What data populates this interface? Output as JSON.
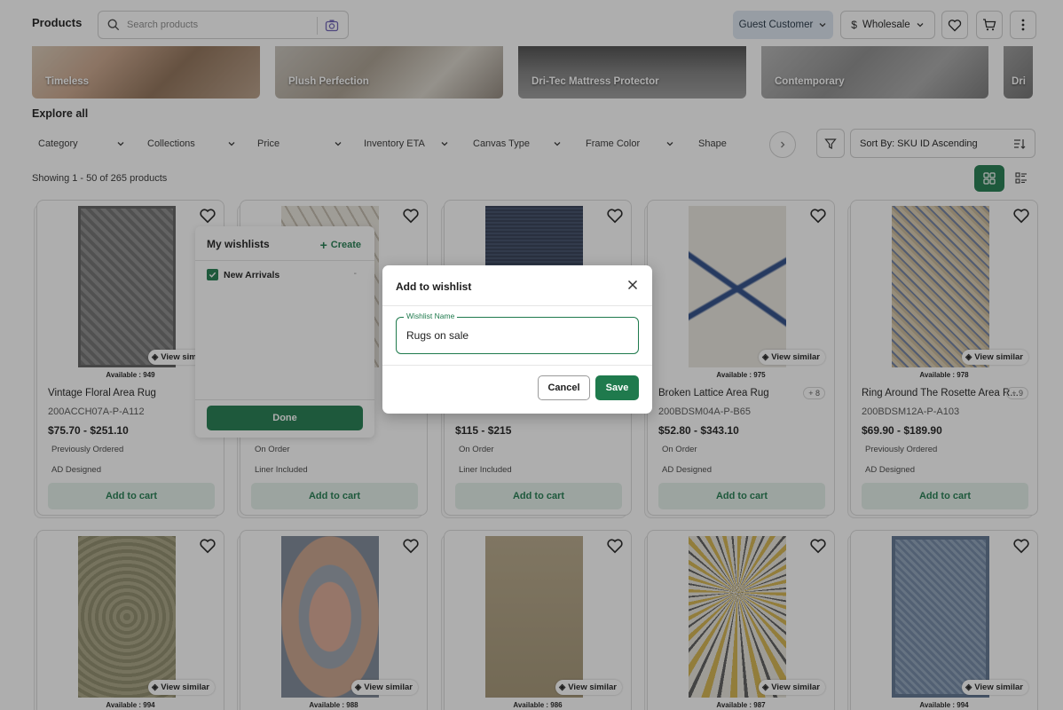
{
  "header": {
    "title": "Products",
    "search_placeholder": "Search products",
    "customer": "Guest Customer",
    "pricing": "Wholesale"
  },
  "collections": [
    "Timeless",
    "Plush Perfection",
    "Dri-Tec Mattress Protector",
    "Contemporary",
    "Dri"
  ],
  "explore_title": "Explore all",
  "filters": [
    "Category",
    "Collections",
    "Price",
    "Inventory ETA",
    "Canvas Type",
    "Frame Color",
    "Shape"
  ],
  "sort_label": "Sort By: SKU ID Ascending",
  "showing": "Showing 1 - 50 of 265 products",
  "view_similar": "View similar",
  "add_to_cart": "Add to cart",
  "products_row1": [
    {
      "availability": "Available : 949",
      "title": "Vintage Floral Area Rug",
      "sku": "200ACCH07A-P-A112",
      "price": "$75.70 - $251.10",
      "tag1": "Previously Ordered",
      "tag2": "AD Designed",
      "variants": ""
    },
    {
      "availability": "",
      "title": "",
      "sku": "",
      "price": "",
      "tag1": "On Order",
      "tag2": "Liner Included",
      "variants": ""
    },
    {
      "availability": "",
      "title": "",
      "sku": "",
      "price": "$115 - $215",
      "tag1": "On Order",
      "tag2": "Liner Included",
      "variants": ""
    },
    {
      "availability": "Available : 975",
      "title": "Broken Lattice Area Rug",
      "sku": "200BDSM04A-P-B65",
      "price": "$52.80 - $343.10",
      "tag1": "On Order",
      "tag2": "AD Designed",
      "variants": "+ 8"
    },
    {
      "availability": "Available : 978",
      "title": "Ring Around The Rosette Area R...",
      "sku": "200BDSM12A-P-A103",
      "price": "$69.90 - $189.90",
      "tag1": "Previously Ordered",
      "tag2": "AD Designed",
      "variants": "+ 9"
    }
  ],
  "products_row2": [
    {
      "availability": "Available : 994"
    },
    {
      "availability": "Available : 988"
    },
    {
      "availability": "Available : 986"
    },
    {
      "availability": "Available : 987"
    },
    {
      "availability": "Available : 994"
    }
  ],
  "wishlists_panel": {
    "title": "My wishlists",
    "create": "Create",
    "item": "New Arrivals",
    "item_count": "-",
    "done": "Done"
  },
  "modal": {
    "title": "Add to wishlist",
    "field_label": "Wishlist Name",
    "field_value": "Rugs on sale",
    "cancel": "Cancel",
    "save": "Save"
  },
  "colors": {
    "accent": "#1f7a4d",
    "guest_pill": "#dbe5ef"
  }
}
